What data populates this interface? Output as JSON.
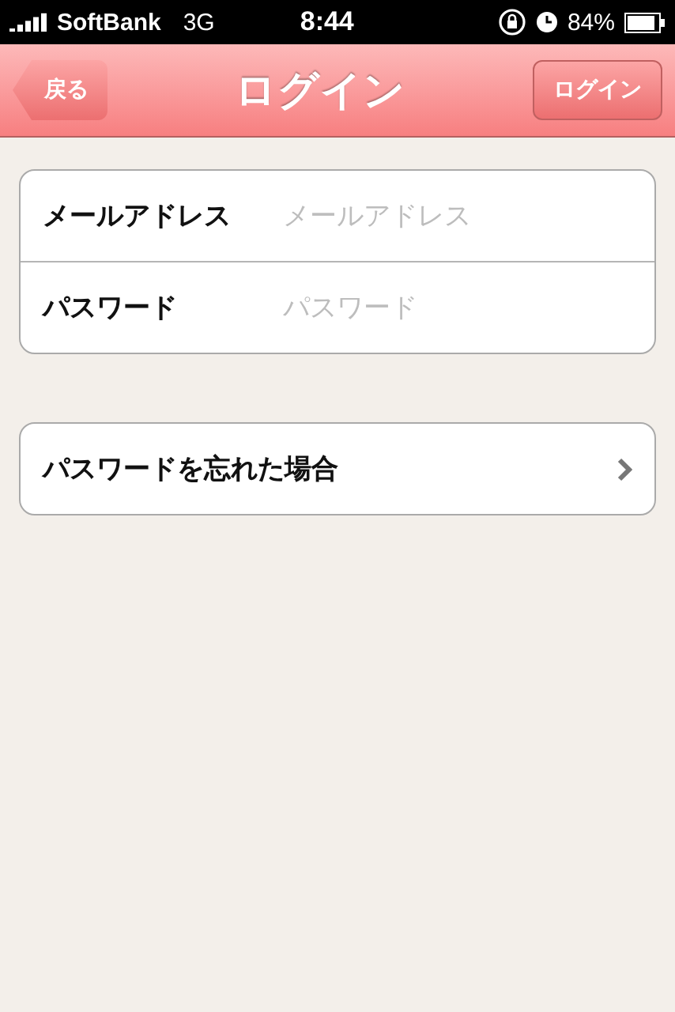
{
  "status_bar": {
    "carrier": "SoftBank",
    "network": "3G",
    "time": "8:44",
    "battery": "84%"
  },
  "nav": {
    "back": "戻る",
    "title": "ログイン",
    "action": "ログイン"
  },
  "fields": [
    {
      "label": "メールアドレス",
      "placeholder": "メールアドレス"
    },
    {
      "label": "パスワード",
      "placeholder": "パスワード"
    }
  ],
  "links": [
    {
      "label": "パスワードを忘れた場合"
    }
  ]
}
